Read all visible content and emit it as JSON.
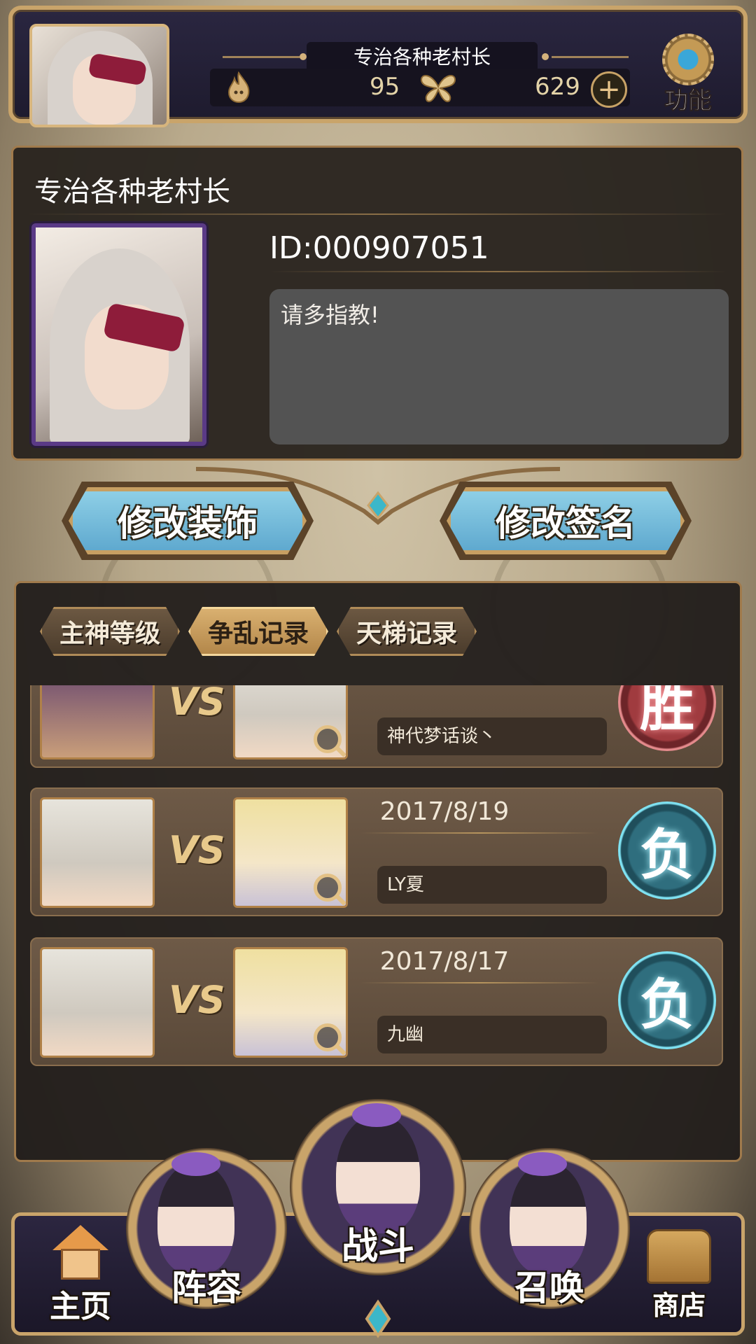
{
  "top_bar": {
    "player_name": "专治各种老村长",
    "resource1_icon": "flame-icon",
    "resource1_value": "95",
    "resource2_icon": "butterfly-icon",
    "resource2_value": "629",
    "add_icon": "plus-icon",
    "function_label": "功能",
    "function_icon": "gear-icon"
  },
  "profile": {
    "name": "专治各种老村长",
    "id_text": "ID:000907051",
    "signature": "请多指教!"
  },
  "actions": {
    "edit_decoration": "修改装饰",
    "edit_signature": "修改签名"
  },
  "tabs": [
    {
      "label": "主神等级",
      "active": false
    },
    {
      "label": "争乱记录",
      "active": true
    },
    {
      "label": "天梯记录",
      "active": false
    }
  ],
  "records": [
    {
      "date": "",
      "opponent": "神代梦话谈丶",
      "result": "胜",
      "vs": "VS"
    },
    {
      "date": "2017/8/19",
      "opponent": "LY夏",
      "result": "负",
      "vs": "VS"
    },
    {
      "date": "2017/8/17",
      "opponent": "九幽",
      "result": "负",
      "vs": "VS"
    }
  ],
  "nav": {
    "home": "主页",
    "lineup": "阵容",
    "battle": "战斗",
    "summon": "召唤",
    "shop": "商店"
  },
  "colors": {
    "gold_border": "#c9a46a",
    "button_blue": "#8ecfe6",
    "win_red": "#a03b3f",
    "lose_teal": "#2f6e7e"
  }
}
